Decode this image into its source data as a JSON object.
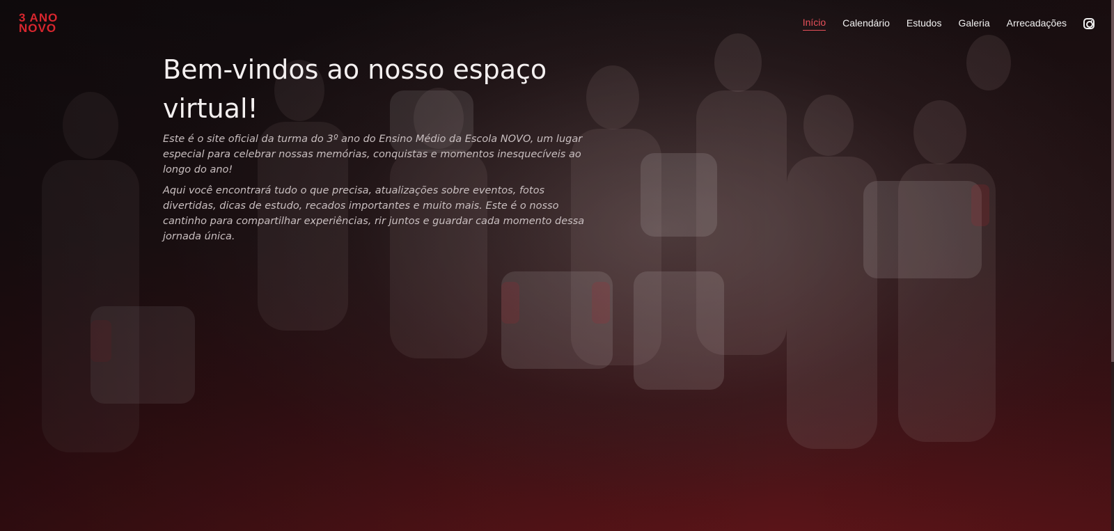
{
  "logo": {
    "line1": "3 ANO",
    "line2": "NOVO"
  },
  "nav": {
    "items": [
      {
        "label": "Início",
        "active": true
      },
      {
        "label": "Calendário",
        "active": false
      },
      {
        "label": "Estudos",
        "active": false
      },
      {
        "label": "Galeria",
        "active": false
      },
      {
        "label": "Arrecadações",
        "active": false
      }
    ],
    "social_icon": "instagram-icon"
  },
  "hero": {
    "title": "Bem-vindos ao nosso espaço virtual!",
    "paragraph1": "Este é o site oficial da turma do 3º ano do Ensino Médio da Escola NOVO, um lugar especial para celebrar nossas memórias, conquistas e momentos inesquecíveis ao longo do ano!",
    "paragraph2": "Aqui você encontrará tudo o que precisa, atualizações sobre eventos, fotos divertidas, dicas de estudo, recados importantes e muito mais. Este é o nosso cantinho para compartilhar experiências, rir juntos e guardar cada momento dessa jornada única."
  },
  "colors": {
    "brand": "#d8262e",
    "nav_active": "#e8505a",
    "text_light": "#f4f0f0"
  }
}
